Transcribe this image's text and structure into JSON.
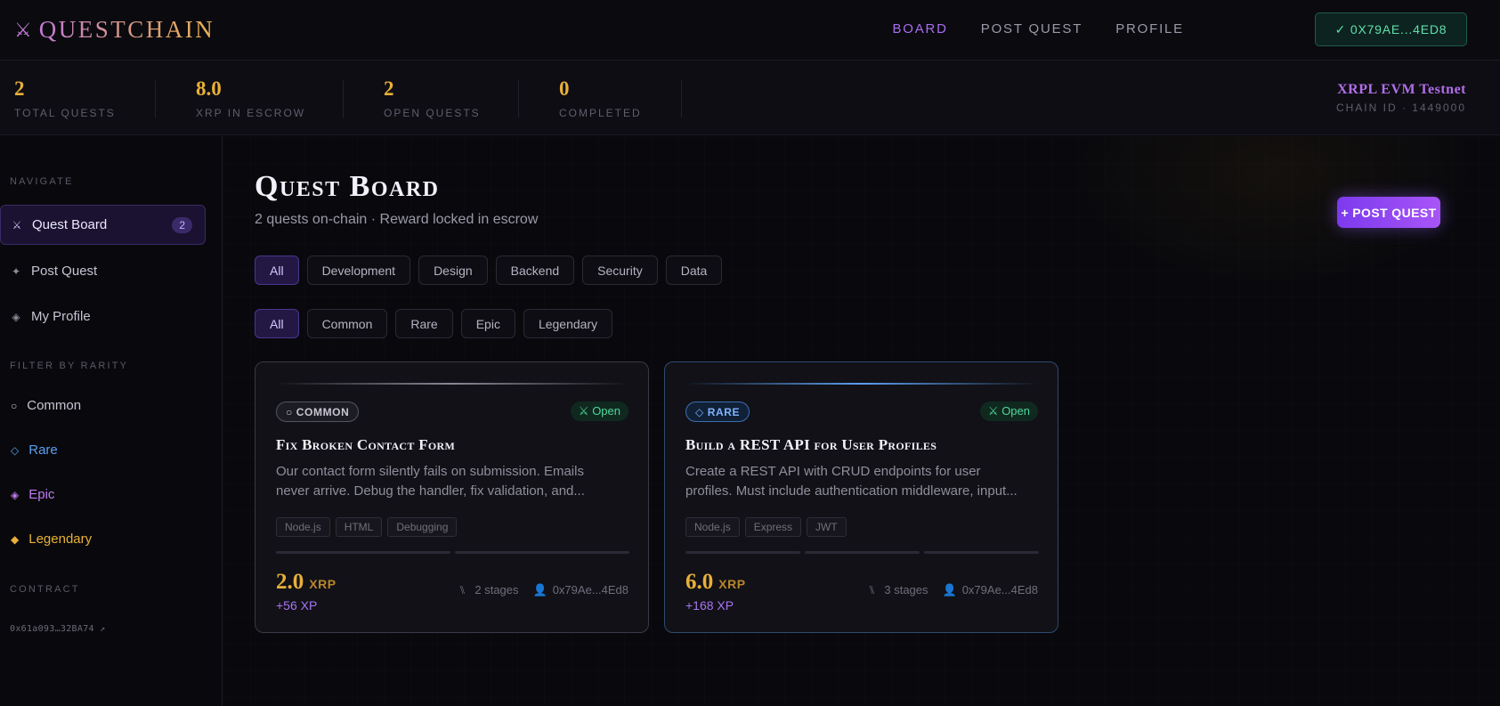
{
  "app": {
    "logo_icon": "crossed-swords-icon",
    "logo_glyph": "⚔",
    "name": "QUESTCHAIN"
  },
  "nav": {
    "items": [
      {
        "label": "BOARD",
        "active": true
      },
      {
        "label": "POST QUEST",
        "active": false
      },
      {
        "label": "PROFILE",
        "active": false
      }
    ],
    "wallet": "✓ 0X79AE...4ED8"
  },
  "stats": [
    {
      "value": "2",
      "label": "TOTAL QUESTS"
    },
    {
      "value": "8.0",
      "label": "XRP IN ESCROW"
    },
    {
      "value": "2",
      "label": "OPEN QUESTS"
    },
    {
      "value": "0",
      "label": "COMPLETED"
    }
  ],
  "network": {
    "name": "XRPL EVM Testnet",
    "chain": "CHAIN ID · 1449000"
  },
  "sidebar": {
    "navigate_heading": "NAVIGATE",
    "items": [
      {
        "icon": "swords-icon",
        "glyph": "⚔",
        "label": "Quest Board",
        "count": "2",
        "active": true
      },
      {
        "icon": "sparkle-icon",
        "glyph": "✦",
        "label": "Post Quest",
        "active": false
      },
      {
        "icon": "diamond-icon",
        "glyph": "◈",
        "label": "My Profile",
        "active": false
      }
    ],
    "rarity_heading": "FILTER BY RARITY",
    "rarities": [
      {
        "glyph": "○",
        "label": "Common",
        "color": "#c6c4d2"
      },
      {
        "glyph": "◇",
        "label": "Rare",
        "color": "#5b9ff0"
      },
      {
        "glyph": "◈",
        "label": "Epic",
        "color": "#c07cf0"
      },
      {
        "glyph": "◆",
        "label": "Legendary",
        "color": "#e8b038"
      }
    ],
    "contract_heading": "CONTRACT",
    "contract": "0x61a093…32BA74 ↗"
  },
  "main": {
    "title": "Quest Board",
    "subtitle": "2 quests on-chain · Reward locked in escrow",
    "post_button": "+ POST QUEST",
    "category_filters": [
      "All",
      "Development",
      "Design",
      "Backend",
      "Security",
      "Data"
    ],
    "rarity_filters": [
      "All",
      "Common",
      "Rare",
      "Epic",
      "Legendary"
    ]
  },
  "quests": [
    {
      "rarity": "○ COMMON",
      "status": "⚔ Open",
      "title": "Fix Broken Contact Form",
      "description": "Our contact form silently fails on submission. Emails never arrive. Debug the handler, fix validation, and...",
      "tags": [
        "Node.js",
        "HTML",
        "Debugging"
      ],
      "stage_count": 2,
      "reward": "2.0",
      "currency": "XRP",
      "xp": "+56 XP",
      "stages_label": "2 stages",
      "stages_glyph": "⑊",
      "owner": "0x79Ae...4Ed8",
      "owner_glyph": "👤"
    },
    {
      "rarity": "◇ RARE",
      "status": "⚔ Open",
      "title": "Build a REST API for User Profiles",
      "description": "Create a REST API with CRUD endpoints for user profiles. Must include authentication middleware, input...",
      "tags": [
        "Node.js",
        "Express",
        "JWT"
      ],
      "stage_count": 3,
      "reward": "6.0",
      "currency": "XRP",
      "xp": "+168 XP",
      "stages_label": "3 stages",
      "stages_glyph": "⑊",
      "owner": "0x79Ae...4Ed8",
      "owner_glyph": "👤"
    }
  ]
}
